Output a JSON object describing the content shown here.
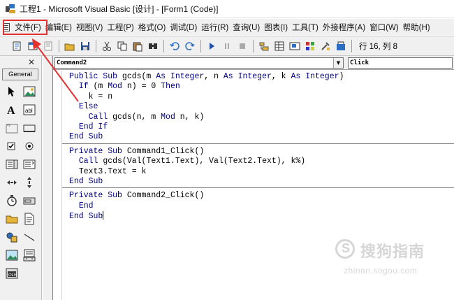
{
  "window": {
    "title": "工程1 - Microsoft Visual Basic [设计] - [Form1 (Code)]"
  },
  "menu": {
    "items": [
      "文件(F)",
      "编辑(E)",
      "视图(V)",
      "工程(P)",
      "格式(O)",
      "调试(D)",
      "运行(R)",
      "查询(U)",
      "图表(I)",
      "工具(T)",
      "外接程序(A)",
      "窗口(W)",
      "帮助(H)"
    ]
  },
  "toolbar": {
    "position": "行 16, 列 8"
  },
  "toolbox": {
    "close_label": "✕",
    "tab_label": "General"
  },
  "code_window": {
    "object_combo": "Command2",
    "procedure_combo": "Click",
    "lines": [
      {
        "indent": "",
        "tokens": [
          [
            "kw",
            "Public Sub "
          ],
          [
            "tx",
            "gcds(m "
          ],
          [
            "kw",
            "As Integer"
          ],
          [
            "tx",
            ", n "
          ],
          [
            "kw",
            "As Integer"
          ],
          [
            "tx",
            ", k "
          ],
          [
            "kw",
            "As Integer"
          ],
          [
            "tx",
            ")"
          ]
        ]
      },
      {
        "indent": "  ",
        "tokens": [
          [
            "kw",
            "If "
          ],
          [
            "tx",
            "(m "
          ],
          [
            "kw",
            "Mod "
          ],
          [
            "tx",
            "n) = 0 "
          ],
          [
            "kw",
            "Then"
          ]
        ]
      },
      {
        "indent": "    ",
        "tokens": [
          [
            "tx",
            "k = n"
          ]
        ]
      },
      {
        "indent": "  ",
        "tokens": [
          [
            "kw",
            "Else"
          ]
        ]
      },
      {
        "indent": "    ",
        "tokens": [
          [
            "kw",
            "Call "
          ],
          [
            "tx",
            "gcds(n, m "
          ],
          [
            "kw",
            "Mod "
          ],
          [
            "tx",
            "n, k)"
          ]
        ]
      },
      {
        "indent": "  ",
        "tokens": [
          [
            "kw",
            "End If"
          ]
        ]
      },
      {
        "indent": "",
        "tokens": [
          [
            "kw",
            "End Sub"
          ]
        ]
      },
      {
        "separator": true
      },
      {
        "indent": "",
        "tokens": [
          [
            "kw",
            "Private Sub "
          ],
          [
            "tx",
            "Command1_Click()"
          ]
        ]
      },
      {
        "indent": "  ",
        "tokens": [
          [
            "kw",
            "Call "
          ],
          [
            "tx",
            "gcds(Val(Text1.Text), Val(Text2.Text), k%)"
          ]
        ]
      },
      {
        "indent": "  ",
        "tokens": [
          [
            "tx",
            "Text3.Text = k"
          ]
        ]
      },
      {
        "indent": "",
        "tokens": [
          [
            "kw",
            "End Sub"
          ]
        ]
      },
      {
        "separator": true
      },
      {
        "indent": "",
        "tokens": [
          [
            "kw",
            "Private Sub "
          ],
          [
            "tx",
            "Command2_Click()"
          ]
        ]
      },
      {
        "indent": "  ",
        "tokens": [
          [
            "kw",
            "End"
          ]
        ]
      },
      {
        "indent": "",
        "tokens": [
          [
            "kw",
            "End Sub"
          ]
        ],
        "caret": true
      }
    ]
  },
  "watermark": {
    "brand": "搜狗指南",
    "url": "zhinan.sogou.com"
  },
  "colors": {
    "keyword": "#00007f",
    "annotation": "#e53030"
  }
}
